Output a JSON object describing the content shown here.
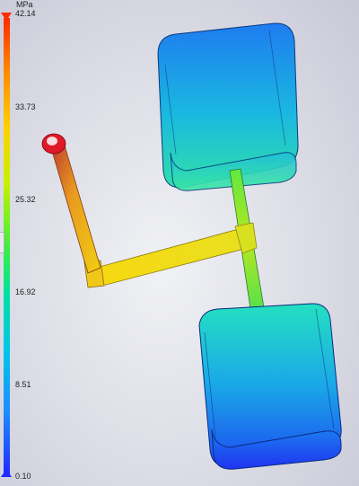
{
  "legend": {
    "unit": "MPa",
    "max_label": "42.14",
    "min_label": "0.10",
    "ticks": [
      "42.14",
      "33.73",
      "25.32",
      "16.92",
      "8.51",
      "0.10"
    ]
  },
  "colors": {
    "max": "#ff2a00",
    "min": "#1e28ff",
    "cavity": "#1fa0e8",
    "runner": "#f5d400",
    "gate": "#a8e020",
    "sprue": "#d86a20"
  },
  "model": {
    "description_icons": [
      "sprue",
      "runner",
      "cavity-top",
      "cavity-bottom",
      "gate"
    ]
  }
}
